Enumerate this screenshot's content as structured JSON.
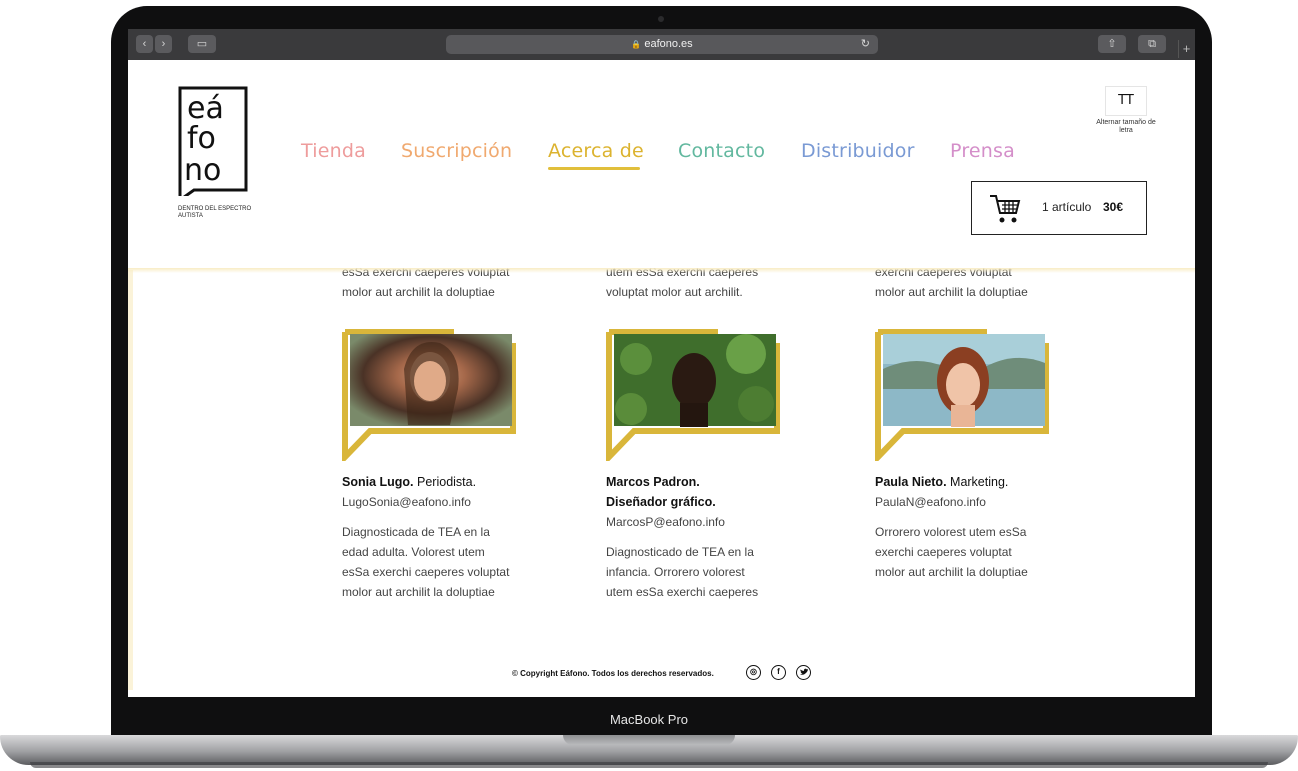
{
  "device": {
    "label": "MacBook Pro"
  },
  "browser": {
    "url": "eafono.es",
    "back_label": "‹",
    "forward_label": "›",
    "sidebar_label": "▭",
    "share_label": "⇧",
    "tabs_label": "⧉",
    "new_tab_label": "+",
    "reload_label": "↻",
    "lock_label": "🔒"
  },
  "site": {
    "logo_text": [
      "eá",
      "fo",
      "no"
    ],
    "logo_tagline": "DENTRO DEL ESPECTRO AUTISTA",
    "menu": [
      {
        "label": "Tienda",
        "color": "#ee9c9c"
      },
      {
        "label": "Suscripción",
        "color": "#f0a96f"
      },
      {
        "label": "Acerca de",
        "color": "#dcb32f",
        "active": true
      },
      {
        "label": "Contacto",
        "color": "#62b89f"
      },
      {
        "label": "Distribuidor",
        "color": "#7a9ad4"
      },
      {
        "label": "Prensa",
        "color": "#d48ec9"
      }
    ],
    "font_toggle": {
      "symbol": "TT",
      "label": "Alternar tamaño de letra"
    },
    "cart": {
      "items": "1 artículo",
      "total": "30€"
    }
  },
  "top_fragments": [
    {
      "line1": "esSa exerchi caeperes voluptat",
      "line2": "molor aut archilit la doluptiae"
    },
    {
      "line1": "utem esSa exerchi caeperes",
      "line2": "voluptat molor aut archilit."
    },
    {
      "line1": "exerchi caeperes voluptat",
      "line2": "molor aut archilit la doluptiae"
    }
  ],
  "team": [
    {
      "name": "Sonia Lugo.",
      "role": "Periodista.",
      "email": "LugoSonia@eafono.info",
      "bio": [
        "Diagnosticada de TEA en la",
        "edad adulta. Volorest utem",
        "esSa exerchi caeperes voluptat",
        "molor aut archilit la doluptiae"
      ]
    },
    {
      "name": "Marcos Padron.",
      "role": "Diseñador gráfico.",
      "email": "MarcosP@eafono.info",
      "bio": [
        "Diagnosticado de TEA en la",
        "infancia. Orrorero volorest",
        "utem esSa exerchi caeperes"
      ]
    },
    {
      "name": "Paula Nieto.",
      "role": "Marketing.",
      "email": "PaulaN@eafono.info",
      "bio": [
        "Orrorero volorest utem esSa",
        "exerchi caeperes voluptat",
        "molor aut archilit la doluptiae"
      ]
    }
  ],
  "footer": {
    "copyright": "© Copyright Eáfono. Todos los derechos reservados.",
    "social": [
      {
        "icon": "instagram-icon",
        "glyph": "◎"
      },
      {
        "icon": "facebook-icon",
        "glyph": "f"
      },
      {
        "icon": "twitter-icon",
        "glyph": "🐦"
      }
    ]
  },
  "colors": {
    "accent_yellow": "#dcb32f",
    "frame_yellow": "#d9b63a"
  }
}
